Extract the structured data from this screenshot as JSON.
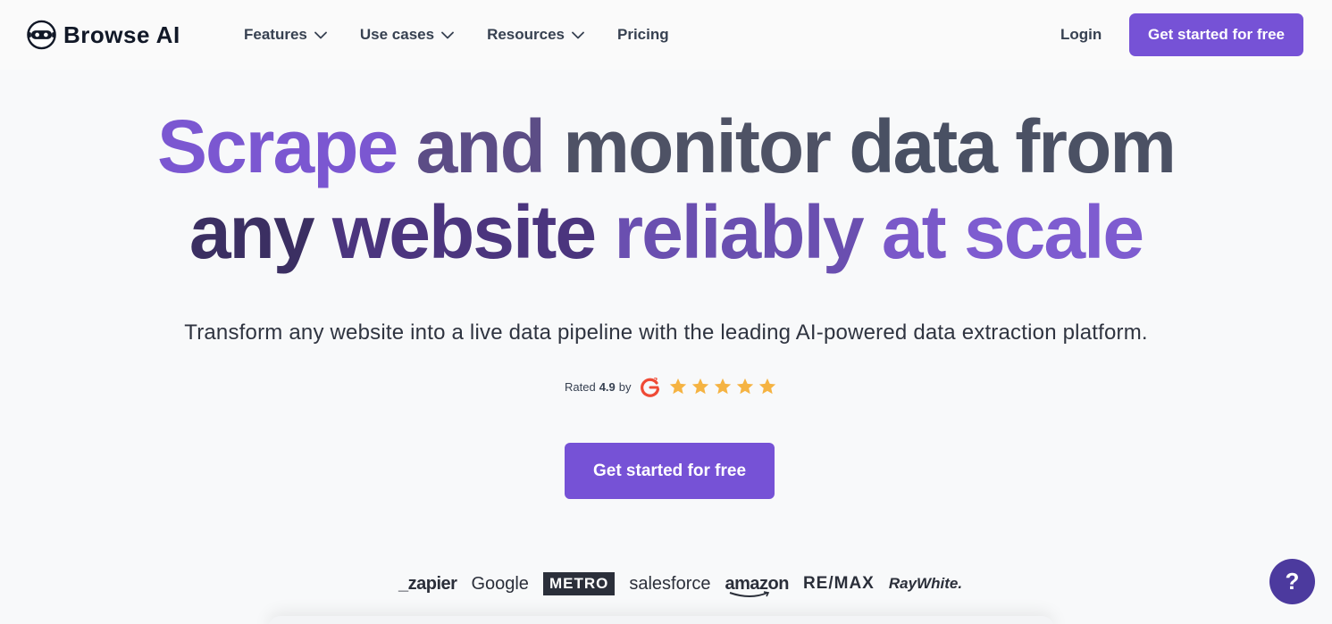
{
  "header": {
    "logo_text": "Browse AI",
    "nav": [
      {
        "label": "Features",
        "has_dropdown": true
      },
      {
        "label": "Use cases",
        "has_dropdown": true
      },
      {
        "label": "Resources",
        "has_dropdown": true
      },
      {
        "label": "Pricing",
        "has_dropdown": false
      }
    ],
    "login_label": "Login",
    "cta_label": "Get started for free"
  },
  "hero": {
    "title_line1": [
      "Scrape",
      "and",
      "monitor",
      "data",
      "from"
    ],
    "title_line2": [
      "any",
      "website",
      "reliably",
      "at",
      "scale"
    ],
    "subtitle": "Transform any website into a live data pipeline with the leading AI-powered data extraction platform.",
    "rating": {
      "prefix": "Rated",
      "score": "4.9",
      "suffix": "by",
      "platform_icon": "g2-icon",
      "stars": 5
    },
    "cta_label": "Get started for free"
  },
  "customer_logos": [
    "_zapier",
    "Google",
    "METRO",
    "salesforce",
    "amazon",
    "RE/MAX",
    "RayWhite."
  ],
  "help_button_label": "?",
  "colors": {
    "accent": "#7652d6",
    "accent_dark": "#4c3a9e",
    "text_dark": "#374151",
    "star": "#f5b342",
    "g2": "#ef4a35"
  }
}
